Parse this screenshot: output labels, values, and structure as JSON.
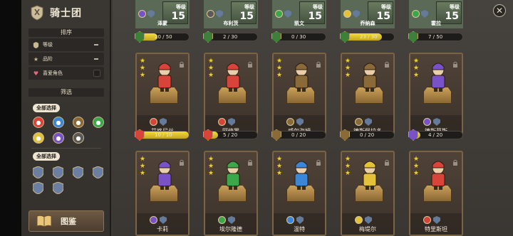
{
  "side_panel": {
    "title": "骑士团",
    "sort_section": "排序",
    "sort_options": [
      {
        "label": "等级"
      },
      {
        "label": "品阶"
      },
      {
        "label": "喜爱角色"
      }
    ],
    "filter_section": "筛选",
    "select_all_1": "全部选择",
    "select_all_2": "全部选择",
    "codex_label": "图鉴"
  },
  "top_row": [
    {
      "name": "泽蒙",
      "level_label": "等级",
      "level": "15",
      "progress": "20 / 50",
      "fill": 0.4
    },
    {
      "name": "布利茨",
      "level_label": "等级",
      "level": "15",
      "progress": "2 / 30",
      "fill": 0.07
    },
    {
      "name": "凯文",
      "level_label": "等级",
      "level": "15",
      "progress": "0 / 30",
      "fill": 0
    },
    {
      "name": "乔纳森",
      "level_label": "等级",
      "level": "15",
      "progress": "23 / 30",
      "fill": 0.77
    },
    {
      "name": "霍拉",
      "level_label": "等级",
      "level": "15",
      "progress": "7 / 50",
      "fill": 0.14
    }
  ],
  "row2": [
    {
      "name": "艾格尼丝",
      "progress": "10 / 10",
      "fill": 1.0,
      "element": "fire"
    },
    {
      "name": "阿修罗",
      "progress": "5 / 20",
      "fill": 0.25,
      "element": "fire"
    },
    {
      "name": "威尔海姆",
      "progress": "0 / 20",
      "fill": 0,
      "element": "earth"
    },
    {
      "name": "德斯佩拉多",
      "progress": "0 / 20",
      "fill": 0,
      "element": "earth"
    },
    {
      "name": "德斯莫斯",
      "progress": "4 / 20",
      "fill": 0.2,
      "element": "dark"
    }
  ],
  "row3": [
    {
      "name": "卡莉",
      "element": "dark"
    },
    {
      "name": "埃尔隆德",
      "element": "green"
    },
    {
      "name": "温特",
      "element": "water"
    },
    {
      "name": "梅堤尔",
      "element": "light"
    },
    {
      "name": "特里斯坦",
      "element": "fire"
    }
  ],
  "colors": {
    "fire": "#d8443a",
    "water": "#3a86d8",
    "earth": "#8a6a38",
    "green": "#3aa84a",
    "light": "#e3c23a",
    "dark": "#7a52c8"
  }
}
